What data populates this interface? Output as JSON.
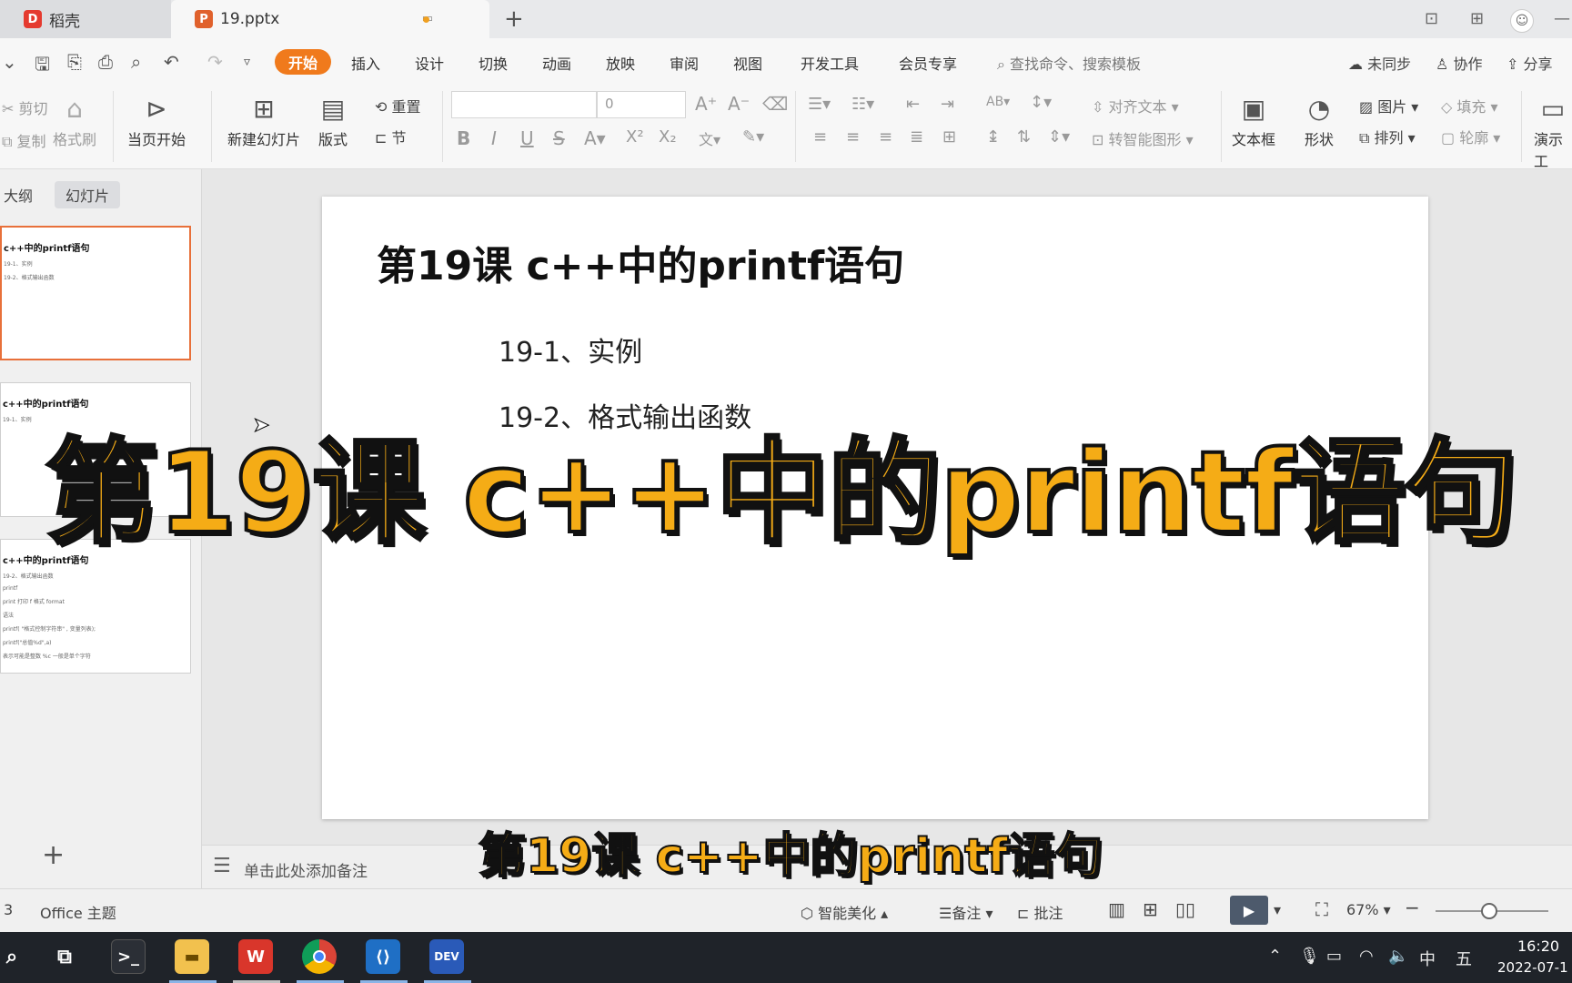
{
  "tabs": {
    "home": "稻壳",
    "document": "19.pptx",
    "new_tab": "+"
  },
  "menu": {
    "items": [
      "开始",
      "插入",
      "设计",
      "切换",
      "动画",
      "放映",
      "审阅",
      "视图",
      "开发工具",
      "会员专享"
    ],
    "active": "开始",
    "search_placeholder": "查找命令、搜索模板",
    "right": [
      "未同步",
      "协作",
      "分享"
    ]
  },
  "ribbon": {
    "cut": "剪切",
    "copy": "复制",
    "format_painter": "格式刷",
    "play_from_current": "当页开始",
    "new_slide": "新建幻灯片",
    "layout": "版式",
    "reset": "重置",
    "section": "节",
    "font_size_value": "0",
    "align_text": "对齐文本",
    "convert_smartart": "转智能图形",
    "textbox": "文本框",
    "shape": "形状",
    "picture": "图片",
    "arrange": "排列",
    "fill": "填充",
    "outline": "轮廓",
    "present_tool": "演示工"
  },
  "left_panel": {
    "tab_outline": "大纲",
    "tab_slides": "幻灯片",
    "thumbnails": [
      {
        "title": "c++中的printf语句",
        "lines": [
          "19-1、实例",
          "19-2、格式输出函数"
        ]
      },
      {
        "title": "c++中的printf语句",
        "lines": [
          "19-1、实例"
        ]
      },
      {
        "title": "c++中的printf语句",
        "lines": [
          "19-2、格式输出函数",
          "printf",
          "print 打印  f 格式 format",
          "语法",
          "printf( \"格式控制字符串\" , 变量列表);",
          "printf(\"总值%d\",a)",
          "表示可能是整数 %c 一般是单个字符"
        ]
      }
    ],
    "add_slide": "+"
  },
  "slide": {
    "title": "第19课 c++中的printf语句",
    "bullets": [
      "19-1、实例",
      "19-2、格式输出函数"
    ]
  },
  "notes_placeholder": "单击此处添加备注",
  "status": {
    "slide_count_fragment": "3",
    "theme": "Office 主题",
    "beautify": "智能美化",
    "notes": "备注",
    "comments": "批注",
    "zoom": "67%"
  },
  "taskbar": {
    "time": "16:20",
    "date": "2022-07-1",
    "ime_lang": "中",
    "ime_mode": "五"
  },
  "overlay": {
    "caption_big": "第19课 c++中的printf语句",
    "caption_small": "第19课  c++中的printf语句"
  },
  "colors": {
    "accent_orange": "#f07a1c",
    "caption_yellow": "#f5ac16",
    "taskbar_bg": "#1f2329"
  }
}
